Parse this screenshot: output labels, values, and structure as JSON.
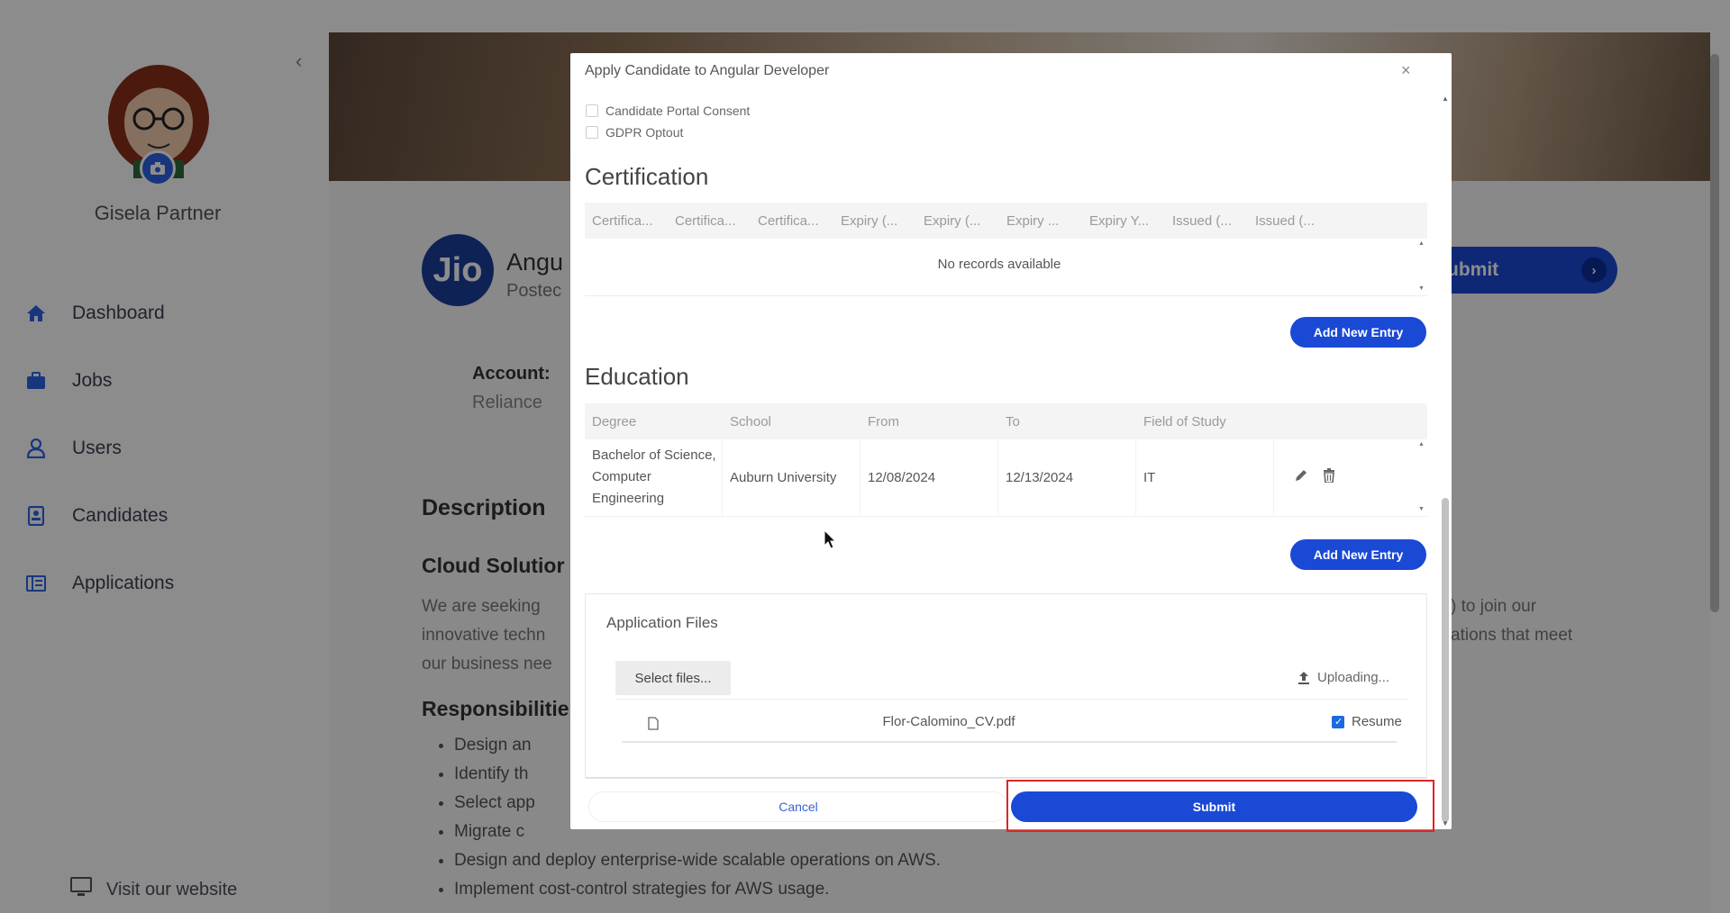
{
  "sidebar": {
    "user_name": "Gisela Partner",
    "items": [
      {
        "label": "Dashboard",
        "icon": "home-icon"
      },
      {
        "label": "Jobs",
        "icon": "briefcase-icon"
      },
      {
        "label": "Users",
        "icon": "user-icon"
      },
      {
        "label": "Candidates",
        "icon": "candidate-card-icon"
      },
      {
        "label": "Applications",
        "icon": "applications-icon"
      }
    ],
    "visit_label": "Visit our website"
  },
  "background": {
    "logo_text": "Jio",
    "job_title": "Angu",
    "posted": "Postec",
    "submit_label": "ubmit",
    "account_label": "Account:",
    "account_value": "Reliance",
    "description_heading": "Description",
    "cloud_heading": "Cloud Solutior",
    "para_left": [
      "We are seeking",
      "innovative techn",
      "our business nee"
    ],
    "para_right": [
      ") to join our",
      "ations that meet"
    ],
    "responsibilities_heading": "Responsibilitie",
    "bullets": [
      "Design an",
      "Identify th",
      "Select app",
      "Migrate c",
      "Design and deploy enterprise-wide scalable operations on AWS.",
      "Implement cost-control strategies for AWS usage."
    ]
  },
  "modal": {
    "title": "Apply Candidate to Angular Developer",
    "close": "×",
    "consent_portal": "Candidate Portal Consent",
    "consent_gdpr": "GDPR Optout",
    "certification": {
      "heading": "Certification",
      "columns": [
        "Certifica...",
        "Certifica...",
        "Certifica...",
        "Expiry (...",
        "Expiry (...",
        "Expiry ...",
        "Expiry Y...",
        "Issued (...",
        "Issued (..."
      ],
      "empty_text": "No records available",
      "add_label": "Add New Entry"
    },
    "education": {
      "heading": "Education",
      "columns": [
        "Degree",
        "School",
        "From",
        "To",
        "Field of Study"
      ],
      "row": {
        "degree": "Bachelor of Science, Computer Engineering",
        "school": "Auburn University",
        "from": "12/08/2024",
        "to": "12/13/2024",
        "field": "IT"
      },
      "add_label": "Add New Entry"
    },
    "files": {
      "heading": "Application Files",
      "select_label": "Select files...",
      "uploading_label": "Uploading...",
      "file_name": "Flor-Calomino_CV.pdf",
      "resume_label": "Resume",
      "resume_checked": true
    },
    "cancel_label": "Cancel",
    "submit_label": "Submit"
  },
  "colors": {
    "primary": "#1a49d6",
    "highlight": "#e02424"
  }
}
